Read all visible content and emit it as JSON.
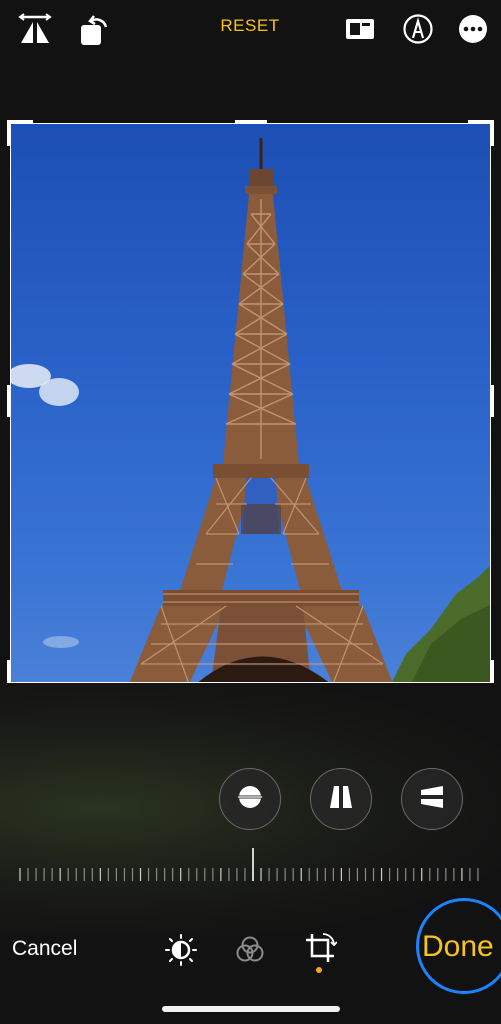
{
  "toolbar": {
    "reset_label": "RESET",
    "left_icons": [
      "flip-horizontal-icon",
      "rotate-icon"
    ],
    "right_icons": [
      "aspect-ratio-icon",
      "markup-icon",
      "more-icon"
    ]
  },
  "photo": {
    "subject": "tower-photo"
  },
  "adjust_buttons": [
    "straighten-icon",
    "vertical-perspective-icon",
    "horizontal-perspective-icon"
  ],
  "bottom": {
    "cancel_label": "Cancel",
    "done_label": "Done",
    "tool_icons": [
      "adjust-icon",
      "filters-icon",
      "crop-icon"
    ],
    "active_tool": "crop-icon"
  },
  "colors": {
    "accent": "#f5c518",
    "highlight_ring": "#1a84ff",
    "background": "#121212"
  }
}
